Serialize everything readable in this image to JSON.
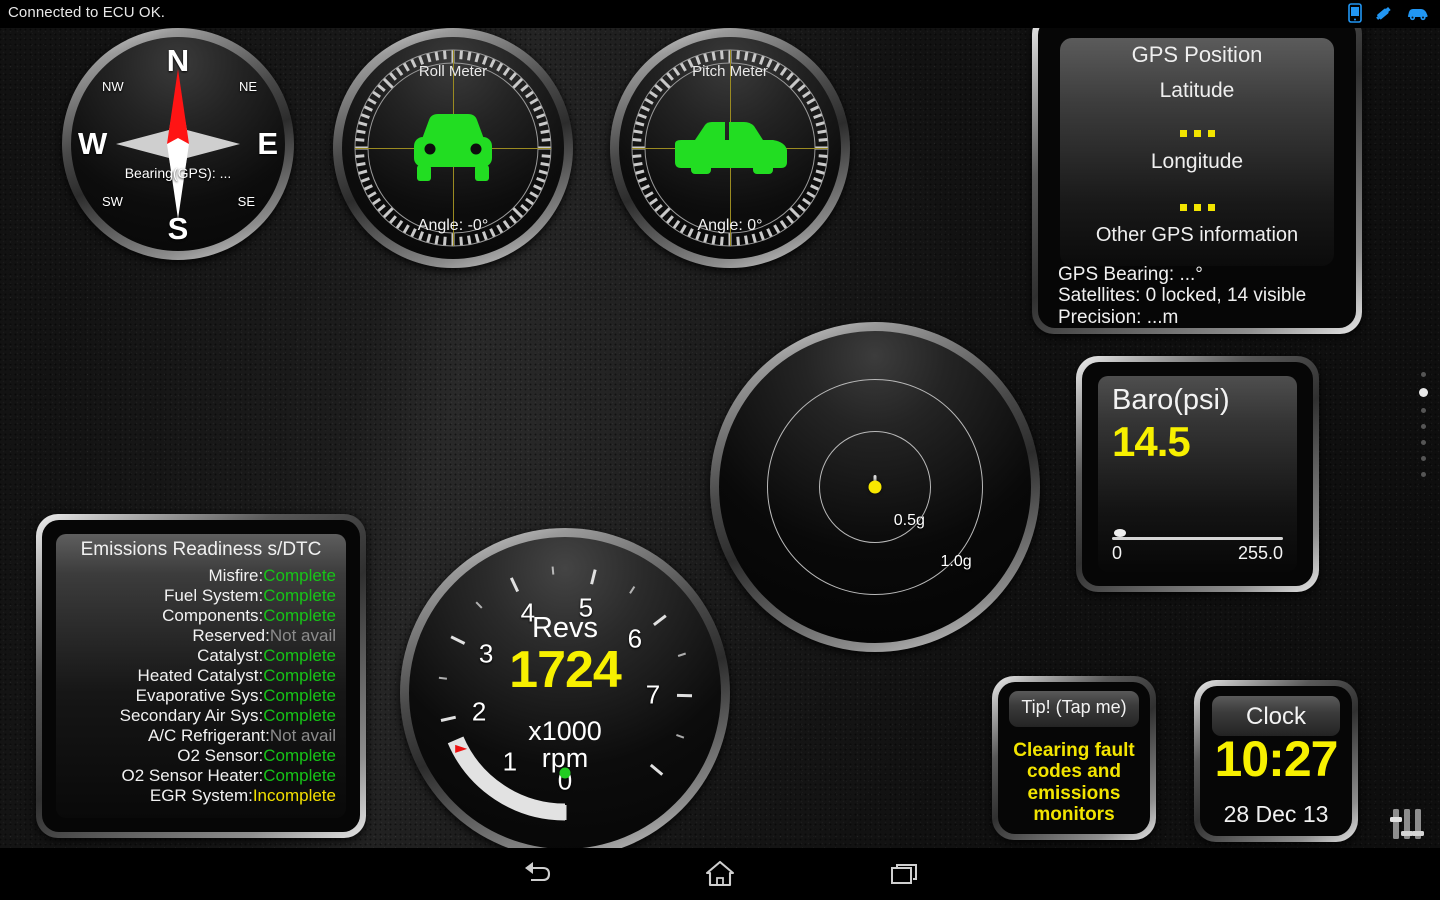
{
  "statusbar": {
    "text": "Connected to ECU OK.",
    "icons": [
      "phone-icon",
      "usb-stick-icon",
      "car-icon"
    ],
    "icon_color": "#2196f3"
  },
  "compass": {
    "name": "compass-gauge",
    "north": "N",
    "south": "S",
    "east": "E",
    "west": "W",
    "nw": "NW",
    "ne": "NE",
    "sw": "SW",
    "se": "SE",
    "bearing": "Bearing(GPS): ...",
    "needle_color": "#ff0000"
  },
  "roll_meter": {
    "title": "Roll Meter",
    "angle": "Angle: -0°",
    "car_color": "#22dd22",
    "crosshair_color": "#9a8a21"
  },
  "pitch_meter": {
    "title": "Pitch Meter",
    "angle": "Angle: 0°",
    "car_color": "#22dd22",
    "crosshair_color": "#9a8a21"
  },
  "revs": {
    "label": "Revs",
    "value": "1724",
    "unit_line1": "x1000",
    "unit_line2": "rpm",
    "value_color": "#f7f000",
    "ticks": [
      "0",
      "1",
      "2",
      "3",
      "4",
      "5",
      "6",
      "7"
    ],
    "arc_value": 1.724,
    "arc_max": 8,
    "marker_color": "#ee1111",
    "indicator_color": "#22cc22"
  },
  "gmeter": {
    "name": "g-force-meter",
    "ring_outer_label": "1.0g",
    "ring_inner_label": "0.5g",
    "dot_color": "#f7e800"
  },
  "gps": {
    "title": "GPS Position",
    "latitude_label": "Latitude",
    "latitude_value": "...",
    "longitude_label": "Longitude",
    "longitude_value": "...",
    "other_title": "Other GPS information",
    "bearing": "GPS Bearing: ...°",
    "satellites": "Satellites: 0 locked, 14 visible",
    "precision": "Precision: ...m"
  },
  "baro": {
    "label": "Baro(psi)",
    "value": "14.5",
    "min": "0",
    "max": "255.0",
    "value_color": "#f7f000"
  },
  "emissions": {
    "title": "Emissions Readiness s/DTC",
    "rows": [
      {
        "key": "Misfire:",
        "value": "Complete",
        "state": "complete"
      },
      {
        "key": "Fuel System:",
        "value": "Complete",
        "state": "complete"
      },
      {
        "key": "Components:",
        "value": "Complete",
        "state": "complete"
      },
      {
        "key": "Reserved:",
        "value": "Not avail",
        "state": "notavail"
      },
      {
        "key": "Catalyst:",
        "value": "Complete",
        "state": "complete"
      },
      {
        "key": "Heated Catalyst:",
        "value": "Complete",
        "state": "complete"
      },
      {
        "key": "Evaporative Sys:",
        "value": "Complete",
        "state": "complete"
      },
      {
        "key": "Secondary Air Sys:",
        "value": "Complete",
        "state": "complete"
      },
      {
        "key": "A/C Refrigerant:",
        "value": "Not avail",
        "state": "notavail"
      },
      {
        "key": "O2 Sensor:",
        "value": "Complete",
        "state": "complete"
      },
      {
        "key": "O2 Sensor Heater:",
        "value": "Complete",
        "state": "complete"
      },
      {
        "key": "EGR System:",
        "value": "Incomplete",
        "state": "incomplete"
      }
    ],
    "colors": {
      "complete": "#17c517",
      "incomplete": "#f2e000",
      "notavail": "#8c8c8c"
    }
  },
  "tip": {
    "title": "Tip! (Tap me)",
    "body": "Clearing fault codes and emissions monitors",
    "body_color": "#f2e400"
  },
  "clock": {
    "title": "Clock",
    "time": "10:27",
    "date": "28 Dec 13",
    "time_color": "#f7f000"
  },
  "page_dots": {
    "count": 7,
    "active_index": 1
  },
  "eq_button": {
    "name": "equalizer-settings-icon"
  },
  "navbar": {
    "back": "back-icon",
    "home": "home-icon",
    "recents": "recent-apps-icon"
  }
}
